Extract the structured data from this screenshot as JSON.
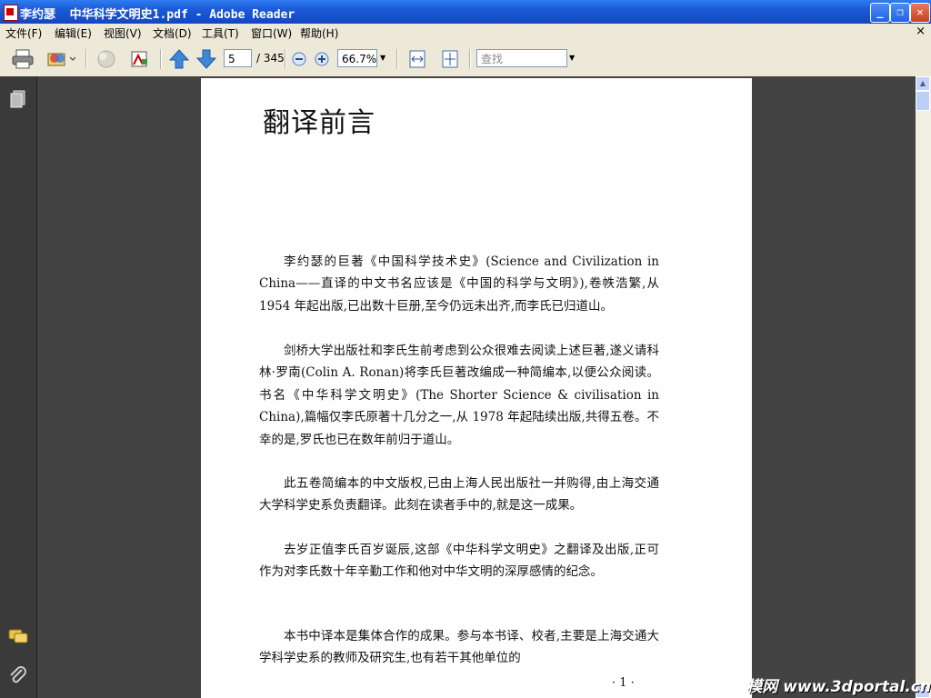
{
  "window": {
    "title": "李约瑟  中华科学文明史1.pdf - Adobe Reader",
    "minimize": "_",
    "restore": "❐",
    "close": "✕"
  },
  "menu": {
    "items": [
      "文件(F)",
      "编辑(E)",
      "视图(V)",
      "文档(D)",
      "工具(T)",
      "窗口(W)",
      "帮助(H)"
    ],
    "close_doc": "×"
  },
  "toolbar": {
    "page_current": "5",
    "page_total": "/ 345",
    "zoom": "66.7%",
    "search_placeholder": "查找",
    "icons": [
      "print-icon",
      "email-icon",
      "sign-icon",
      "ocr-icon",
      "prev-page-icon",
      "next-page-icon",
      "zoom-out-icon",
      "zoom-in-icon",
      "fit-width-icon",
      "fit-page-icon"
    ]
  },
  "document": {
    "heading": "翻译前言",
    "paragraphs": [
      "李约瑟的巨著《中国科学技术史》(Science and Civilization in China——直译的中文书名应该是《中国的科学与文明》),卷帙浩繁,从 1954 年起出版,已出数十巨册,至今仍远未出齐,而李氏已归道山。",
      "剑桥大学出版社和李氏生前考虑到公众很难去阅读上述巨著,遂义请科林·罗南(Colin A. Ronan)将李氏巨著改编成一种简编本,以便公众阅读。书名《中华科学文明史》(The Shorter Science & civilisation in China),篇幅仅李氏原著十几分之一,从 1978 年起陆续出版,共得五卷。不幸的是,罗氏也已在数年前归于道山。",
      "此五卷简编本的中文版权,已由上海人民出版社一并购得,由上海交通大学科学史系负责翻译。此刻在读者手中的,就是这一成果。",
      "去岁正值李氏百岁诞辰,这部《中华科学文明史》之翻译及出版,正可作为对李氏数十年辛勤工作和他对中华文明的深厚感情的纪念。",
      "本书中译本是集体合作的成果。参与本书译、校者,主要是上海交通大学科学史系的教师及研究生,也有若干其他单位的"
    ],
    "page_number": "· 1 ·"
  },
  "watermark": "模网 www.3dportal.cn",
  "colors": {
    "titlebar": "#1b5ad8",
    "chrome": "#ece9d8",
    "doc_bg": "#434343"
  }
}
